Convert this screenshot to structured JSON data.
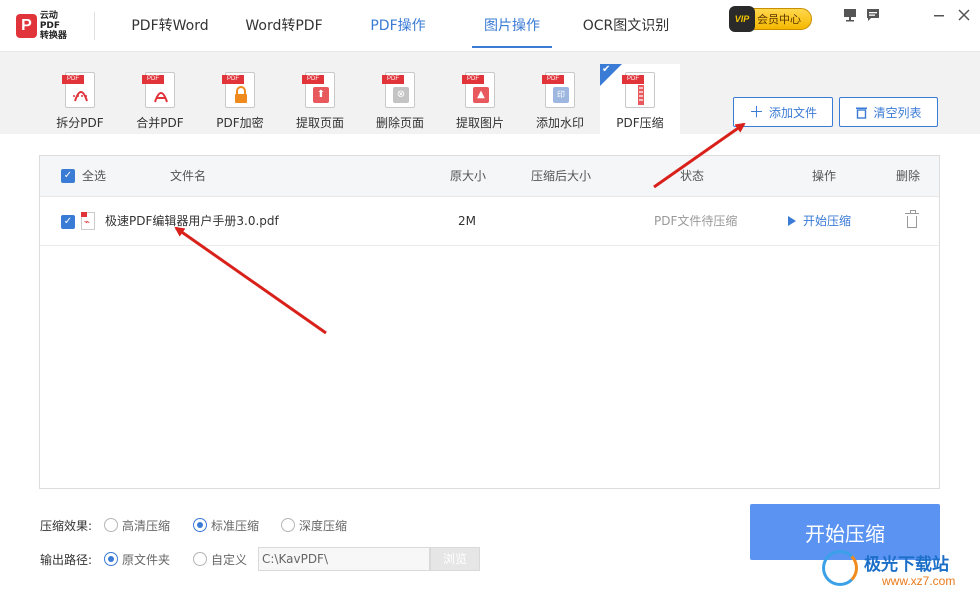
{
  "app": {
    "logo_line1": "云动PDF",
    "logo_line2": "转换器",
    "main_tabs": [
      {
        "label": "PDF转Word"
      },
      {
        "label": "Word转PDF"
      },
      {
        "label": "PDF操作"
      },
      {
        "label": "图片操作"
      },
      {
        "label": "OCR图文识别"
      }
    ],
    "vip_badge": "VIP",
    "vip_label": "会员中心",
    "window_icons": [
      "monitor-icon",
      "message-icon",
      "minimize-icon",
      "close-icon"
    ]
  },
  "toolbar": {
    "tools": [
      {
        "label": "拆分PDF",
        "tag": "PDF",
        "icon": "split-icon",
        "color": "#e1333a"
      },
      {
        "label": "合并PDF",
        "tag": "PDF",
        "icon": "merge-icon",
        "color": "#e1333a"
      },
      {
        "label": "PDF加密",
        "tag": "PDF",
        "icon": "lock-icon",
        "color": "#f08a1c"
      },
      {
        "label": "提取页面",
        "tag": "PDF",
        "icon": "extract-page-icon",
        "color": "#e8595e"
      },
      {
        "label": "删除页面",
        "tag": "PDF",
        "icon": "delete-page-icon",
        "color": "#b9b9b9"
      },
      {
        "label": "提取图片",
        "tag": "PDF",
        "icon": "extract-image-icon",
        "color": "#e8595e"
      },
      {
        "label": "添加水印",
        "tag": "PDF",
        "icon": "watermark-icon",
        "color": "#9db7e0"
      },
      {
        "label": "PDF压缩",
        "tag": "PDF",
        "icon": "compress-icon",
        "color": "#e8595e"
      }
    ],
    "add_file": "添加文件",
    "clear_list": "清空列表"
  },
  "table": {
    "headers": {
      "select_all": "全选",
      "filename": "文件名",
      "original_size": "原大小",
      "compressed_size": "压缩后大小",
      "status": "状态",
      "action": "操作",
      "delete": "删除"
    },
    "rows": [
      {
        "filename": "极速PDF编辑器用户手册3.0.pdf",
        "original_size": "2M",
        "compressed_size": "",
        "status": "PDF文件待压缩",
        "action": "开始压缩"
      }
    ]
  },
  "options": {
    "effect_label": "压缩效果:",
    "effects": [
      {
        "label": "高清压缩",
        "selected": false
      },
      {
        "label": "标准压缩",
        "selected": true
      },
      {
        "label": "深度压缩",
        "selected": false
      }
    ],
    "output_label": "输出路径:",
    "outputs": [
      {
        "label": "原文件夹",
        "selected": true
      },
      {
        "label": "自定义",
        "selected": false
      }
    ],
    "path_value": "C:\\KavPDF\\",
    "browse": "浏览"
  },
  "start_button": "开始压缩",
  "watermark": {
    "line1": "极光下载站",
    "line2": "www.xz7.com"
  },
  "colors": {
    "accent": "#3a7bd5",
    "start_button": "#5b93f2",
    "annotation_arrow": "#d9211c"
  }
}
